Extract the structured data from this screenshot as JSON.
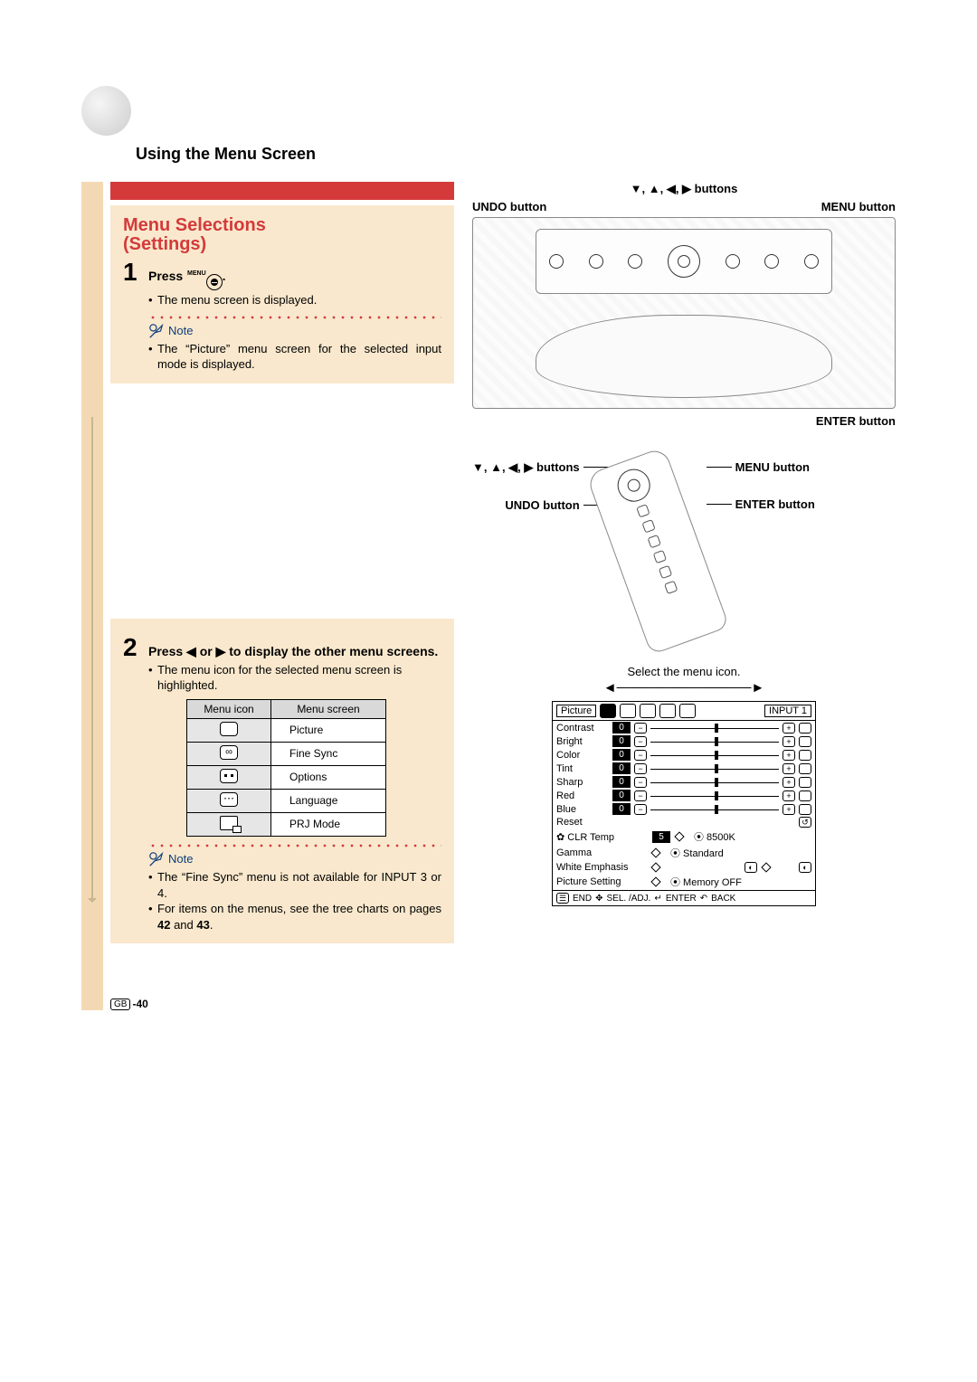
{
  "heading": "Using the Menu Screen",
  "title_line1": "Menu Selections",
  "title_line2": "(Settings)",
  "step1": {
    "num": "1",
    "label_prefix": "Press ",
    "menu_label": "MENU",
    "bullet": "The menu screen is displayed.",
    "note_word": "Note",
    "note_bullet": "The “Picture” menu screen for the selected input mode is displayed."
  },
  "step2": {
    "num": "2",
    "label": "Press ◀ or ▶ to display the other menu screens.",
    "bullet": "The menu icon for the selected menu screen is highlighted.",
    "table": {
      "head_icon": "Menu icon",
      "head_screen": "Menu screen",
      "rows": [
        {
          "screen": "Picture"
        },
        {
          "screen": "Fine Sync"
        },
        {
          "screen": "Options"
        },
        {
          "screen": "Language"
        },
        {
          "screen": "PRJ Mode"
        }
      ]
    },
    "note_word": "Note",
    "note_bullet1": "The “Fine Sync” menu is not available for INPUT 3 or 4.",
    "note_bullet2_a": "For items on the menus, see the tree charts on pages ",
    "note_bullet2_b": "42",
    "note_bullet2_c": " and ",
    "note_bullet2_d": "43",
    "note_bullet2_e": "."
  },
  "right": {
    "arrows_label": "▼, ▲, ◀, ▶ buttons",
    "undo_label": "UNDO button",
    "menu_label": "MENU button",
    "enter_label": "ENTER button",
    "arrows_label2": "▼, ▲, ◀, ▶ buttons",
    "undo_label2": "UNDO button",
    "menu_label2": "MENU button",
    "enter_label2": "ENTER button",
    "select_caption": "Select the menu icon."
  },
  "osd": {
    "title": "Picture",
    "input": "INPUT 1",
    "rows": [
      {
        "name": "Contrast",
        "val": "0",
        "knob": 50
      },
      {
        "name": "Bright",
        "val": "0",
        "knob": 50
      },
      {
        "name": "Color",
        "val": "0",
        "knob": 50
      },
      {
        "name": "Tint",
        "val": "0",
        "knob": 50
      },
      {
        "name": "Sharp",
        "val": "0",
        "knob": 50
      },
      {
        "name": "Red",
        "val": "0",
        "knob": 50
      },
      {
        "name": "Blue",
        "val": "0",
        "knob": 50
      }
    ],
    "reset": "Reset",
    "sub": [
      {
        "name": "CLR Temp",
        "badge": "5",
        "right": "8500K"
      },
      {
        "name": "Gamma",
        "right": "Standard"
      },
      {
        "name": "White Emphasis",
        "right": ""
      },
      {
        "name": "Picture Setting",
        "right": "Memory OFF"
      }
    ],
    "footer": {
      "end": "END",
      "sel": "SEL. /ADJ.",
      "enter": "ENTER",
      "back": "BACK"
    }
  },
  "page_number": "-40",
  "gb": "GB"
}
